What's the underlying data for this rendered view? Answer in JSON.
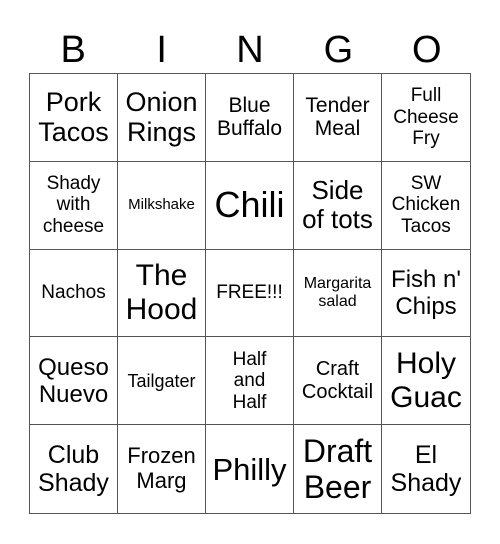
{
  "header": [
    "B",
    "I",
    "N",
    "G",
    "O"
  ],
  "cells": [
    "Pork\nTacos",
    "Onion\nRings",
    "Blue\nBuffalo",
    "Tender\nMeal",
    "Full\nCheese\nFry",
    "Shady\nwith\ncheese",
    "Milkshake",
    "Chili",
    "Side\nof tots",
    "SW\nChicken\nTacos",
    "Nachos",
    "The\nHood",
    "FREE!!!",
    "Margarita\nsalad",
    "Fish n'\nChips",
    "Queso\nNuevo",
    "Tailgater",
    "Half\nand\nHalf",
    "Craft\nCocktail",
    "Holy\nGuac",
    "Club\nShady",
    "Frozen\nMarg",
    "Philly",
    "Draft\nBeer",
    "El\nShady"
  ]
}
